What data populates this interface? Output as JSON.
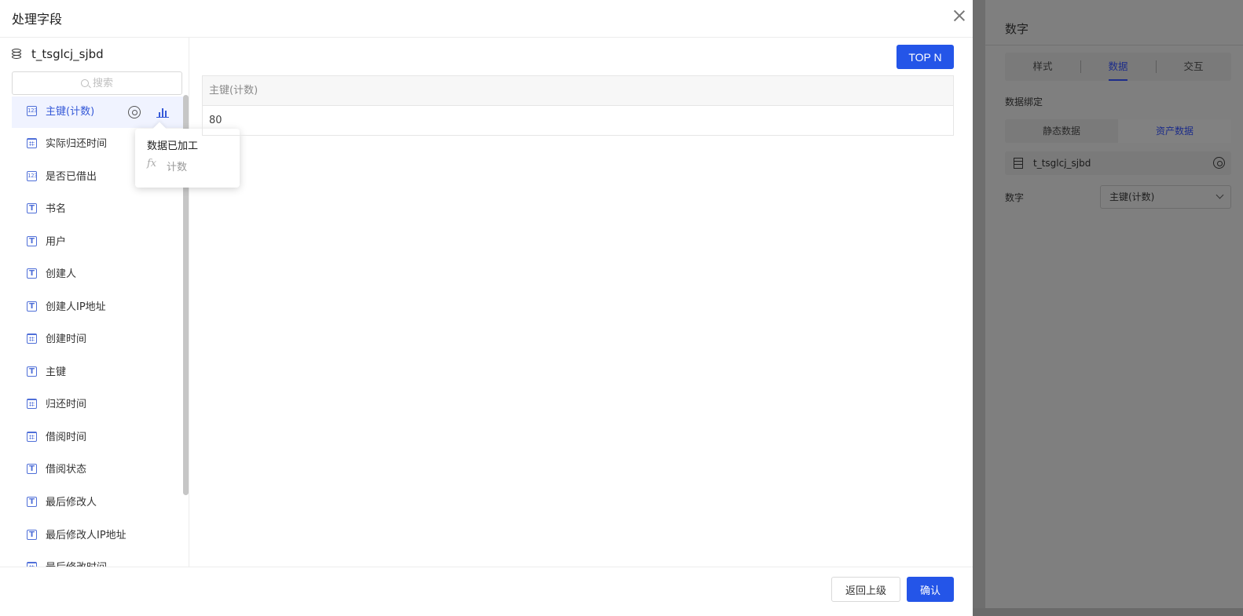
{
  "dialog": {
    "title": "处理字段",
    "datasource": "t_tsglcj_sjbd",
    "search_placeholder": "搜索",
    "fields": [
      {
        "label": "主键(计数)",
        "icon": "number-type-icon",
        "active": true
      },
      {
        "label": "实际归还时间",
        "icon": "date-type-icon"
      },
      {
        "label": "是否已借出",
        "icon": "number-type-icon"
      },
      {
        "label": "书名",
        "icon": "text-type-icon"
      },
      {
        "label": "用户",
        "icon": "text-type-icon"
      },
      {
        "label": "创建人",
        "icon": "text-type-icon"
      },
      {
        "label": "创建人IP地址",
        "icon": "text-type-icon"
      },
      {
        "label": "创建时间",
        "icon": "date-type-icon"
      },
      {
        "label": "主键",
        "icon": "text-type-icon"
      },
      {
        "label": "归还时间",
        "icon": "date-type-icon"
      },
      {
        "label": "借阅时间",
        "icon": "date-type-icon"
      },
      {
        "label": "借阅状态",
        "icon": "text-type-icon"
      },
      {
        "label": "最后修改人",
        "icon": "text-type-icon"
      },
      {
        "label": "最后修改人IP地址",
        "icon": "text-type-icon"
      },
      {
        "label": "最后修改时间",
        "icon": "date-type-icon"
      }
    ],
    "tooltip": {
      "title": "数据已加工",
      "fx": "fx",
      "text": "计数"
    },
    "topn_label": "TOP N",
    "table": {
      "header": "主键(计数)",
      "value": "80"
    },
    "back_label": "返回上级",
    "confirm_label": "确认"
  },
  "side_panel": {
    "title": "数字",
    "tabs": [
      "样式",
      "数据",
      "交互"
    ],
    "active_tab": "数据",
    "binding_label": "数据绑定",
    "segments": [
      "静态数据",
      "资产数据"
    ],
    "active_segment": "资产数据",
    "datasource": "t_tsglcj_sjbd",
    "number_label": "数字",
    "number_value": "主键(计数)"
  },
  "colors": {
    "primary": "#2455e8",
    "active_text": "#3559d8",
    "overlay": "#7d7d7d"
  }
}
